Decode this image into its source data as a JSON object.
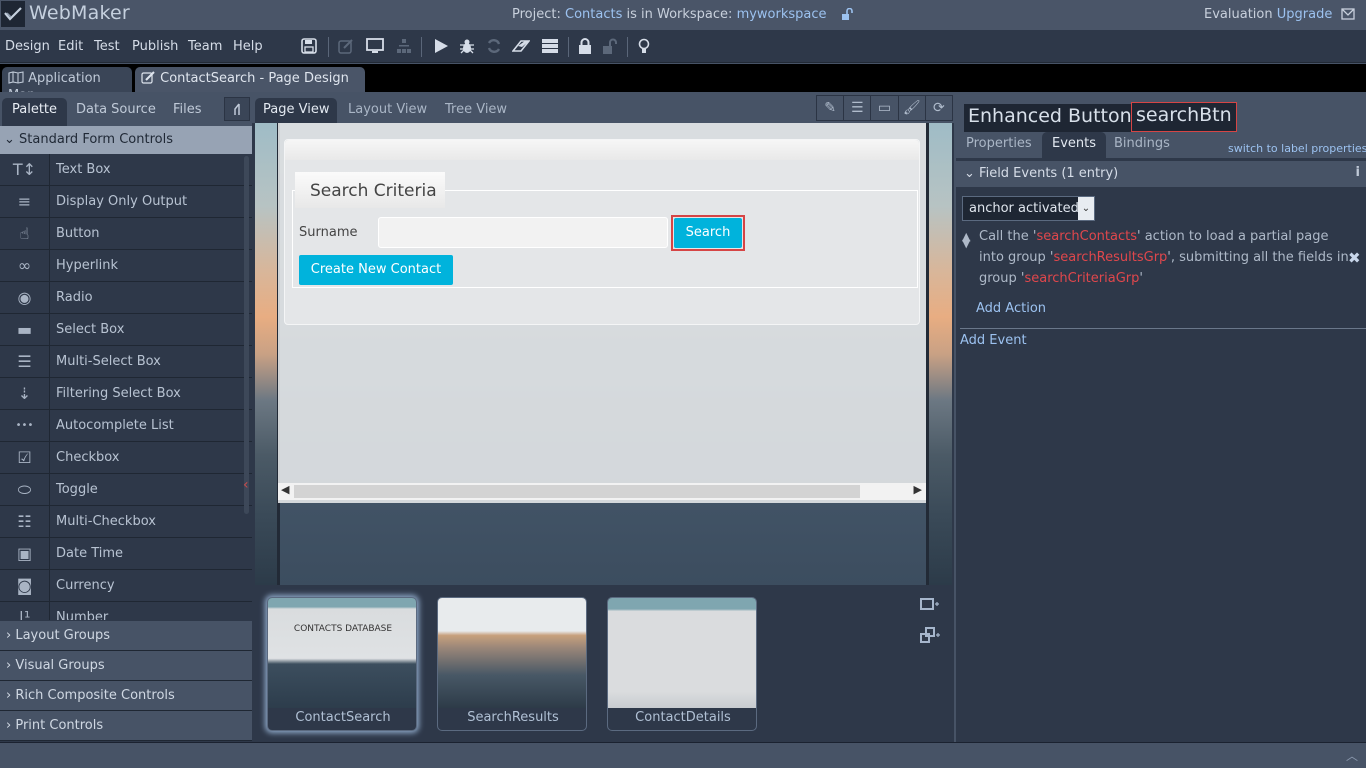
{
  "app": {
    "name": "WebMaker",
    "project_prefix": "Project: ",
    "project_name": "Contacts",
    "workspace_mid": " is in Workspace: ",
    "workspace_name": "myworkspace",
    "evaluation": "Evaluation",
    "upgrade": "Upgrade"
  },
  "menu": [
    "Design",
    "Edit",
    "Test",
    "Publish",
    "Team",
    "Help"
  ],
  "toolbar_icons": [
    "save-icon",
    "edit-icon",
    "monitor-icon",
    "sitemap-icon",
    "run-icon",
    "debug-icon",
    "refresh-icon",
    "eraser-icon",
    "server-icon",
    "lock-icon",
    "unlock-icon",
    "lightbulb-icon"
  ],
  "doc_tabs": [
    {
      "label": "Application Map",
      "icon": "map-icon",
      "active": false
    },
    {
      "label": "ContactSearch - Page Design",
      "icon": "edit-icon",
      "active": true,
      "close": "✖"
    }
  ],
  "left_panel": {
    "tabs": [
      "Palette",
      "Data Source",
      "Files"
    ],
    "active_tab": "Palette",
    "section": "Standard Form Controls",
    "items": [
      {
        "label": "Text Box",
        "icon": "text-box-icon"
      },
      {
        "label": "Display Only Output",
        "icon": "align-left-icon"
      },
      {
        "label": "Button",
        "icon": "hand-pointer-icon"
      },
      {
        "label": "Hyperlink",
        "icon": "link-icon"
      },
      {
        "label": "Radio",
        "icon": "radio-icon"
      },
      {
        "label": "Select Box",
        "icon": "minus-icon"
      },
      {
        "label": "Multi-Select Box",
        "icon": "bars-icon"
      },
      {
        "label": "Filtering Select Box",
        "icon": "sort-filter-icon"
      },
      {
        "label": "Autocomplete List",
        "icon": "ellipsis-icon"
      },
      {
        "label": "Checkbox",
        "icon": "checkbox-icon"
      },
      {
        "label": "Toggle",
        "icon": "toggle-icon"
      },
      {
        "label": "Multi-Checkbox",
        "icon": "list-icon"
      },
      {
        "label": "Date Time",
        "icon": "calendar-icon"
      },
      {
        "label": "Currency",
        "icon": "money-icon"
      },
      {
        "label": "Number",
        "icon": "number-icon"
      }
    ],
    "groups": [
      "Layout Groups",
      "Visual Groups",
      "Rich Composite Controls",
      "Print Controls"
    ]
  },
  "center": {
    "view_tabs": [
      "Page View",
      "Layout View",
      "Tree View"
    ],
    "active_view": "Page View",
    "view_tools": [
      "edit-icon",
      "list-icon",
      "layout-icon",
      "brush-icon",
      "refresh-icon"
    ],
    "form": {
      "legend": "Search Criteria",
      "surname_label": "Surname",
      "surname_value": "",
      "search_button": "Search",
      "create_button": "Create New Contact"
    },
    "pages": [
      {
        "label": "ContactSearch",
        "selected": true,
        "preview_title": "CONTACTS DATABASE"
      },
      {
        "label": "SearchResults",
        "selected": false
      },
      {
        "label": "ContactDetails",
        "selected": false
      }
    ]
  },
  "right_panel": {
    "title": "Enhanced Button:",
    "name": "searchBtn",
    "tabs": [
      "Properties",
      "Events",
      "Bindings"
    ],
    "active_tab": "Events",
    "switch_link": "switch to label properties",
    "field_events_header": "Field Events (1 entry)",
    "event_trigger": "anchor activated",
    "action": {
      "t1": "Call the '",
      "action_name": "searchContacts",
      "t2": "' action to load a partial page into group '",
      "target_group": "searchResultsGrp",
      "t3": "', submitting all the fields in group '",
      "source_group": "searchCriteriaGrp",
      "t4": "'"
    },
    "add_action": "Add Action",
    "add_event": "Add Event"
  },
  "colors": {
    "accent_button": "#00b3dc",
    "selection_outline": "#d64545",
    "link": "#9cc2f0",
    "reference": "#e0474c"
  }
}
